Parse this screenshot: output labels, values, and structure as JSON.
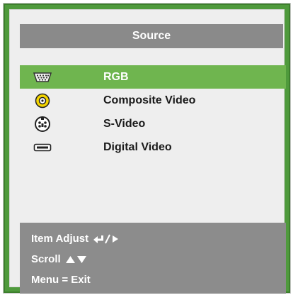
{
  "title": "Source",
  "items": [
    {
      "label": "RGB",
      "icon": "vga-connector-icon",
      "selected": true
    },
    {
      "label": "Composite Video",
      "icon": "composite-rca-icon",
      "selected": false
    },
    {
      "label": "S-Video",
      "icon": "s-video-connector-icon",
      "selected": false
    },
    {
      "label": "Digital Video",
      "icon": "hdmi-connector-icon",
      "selected": false
    }
  ],
  "help": {
    "item_adjust": "Item Adjust",
    "scroll": "Scroll",
    "menu_exit": "Menu = Exit"
  },
  "colors": {
    "frame": "#4f9a3c",
    "title_bar": "#8a8a8a",
    "selected": "#6fb54f",
    "panel": "#eeeeee",
    "help_bar": "#8c8c8c"
  }
}
